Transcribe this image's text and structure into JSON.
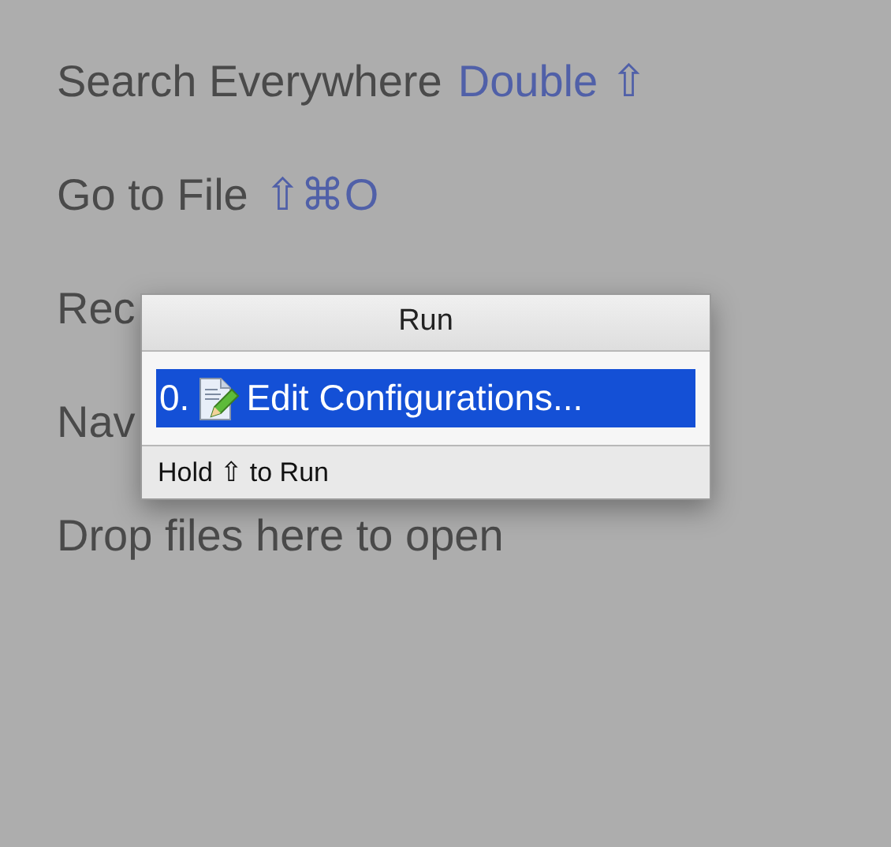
{
  "hints": [
    {
      "text": "Search Everywhere",
      "shortcut": "Double ⇧"
    },
    {
      "text": "Go to File",
      "shortcut": "⇧⌘O"
    },
    {
      "text": "Rec"
    },
    {
      "text": "Nav"
    },
    {
      "text": "Drop files here to open"
    }
  ],
  "popup": {
    "title": "Run",
    "items": [
      {
        "number": "0.",
        "label": "Edit Configurations...",
        "selected": true
      }
    ],
    "footer": "Hold ⇧ to Run"
  }
}
